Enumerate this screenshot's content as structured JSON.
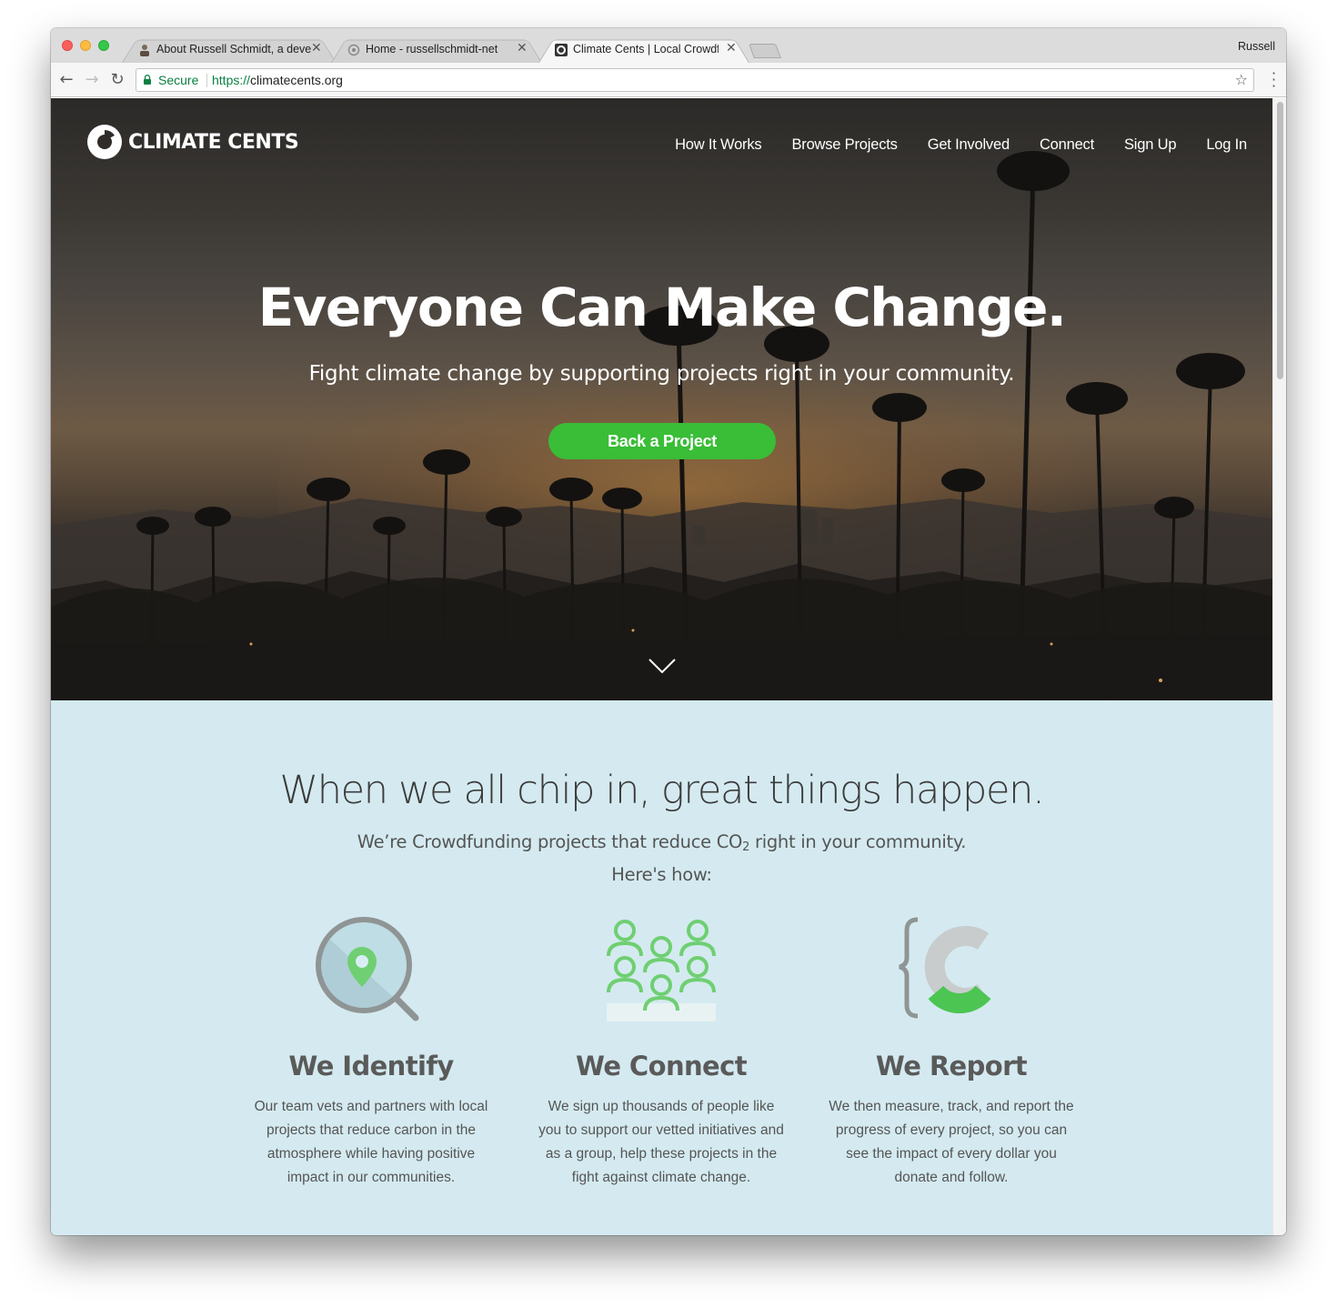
{
  "browser": {
    "tabs": [
      {
        "title": "About Russell Schmidt, a deve",
        "active": false
      },
      {
        "title": "Home - russellschmidt-net",
        "active": false
      },
      {
        "title": "Climate Cents | Local Crowdfu",
        "active": true
      }
    ],
    "profile": "Russell",
    "security_label": "Secure",
    "url_scheme": "https://",
    "url_host": "climatecents.org"
  },
  "site": {
    "logo_text": "CLIMATE CENTS",
    "nav": [
      "How It Works",
      "Browse Projects",
      "Get Involved",
      "Connect",
      "Sign Up",
      "Log In"
    ]
  },
  "hero": {
    "title": "Everyone Can Make Change.",
    "subtitle": "Fight climate change by supporting projects right in your community.",
    "cta": "Back a Project"
  },
  "info": {
    "title": "When we all chip in, great things happen.",
    "subtitle_before": "We’re Crowdfunding projects that reduce CO",
    "subtitle_sub": "2",
    "subtitle_after": " right in your community.",
    "subtitle_line2": "Here's how:",
    "features": [
      {
        "icon": "magnifier-location-icon",
        "title": "We Identify",
        "text": "Our team vets and partners with local projects that reduce carbon in the atmosphere while having positive impact in our communities."
      },
      {
        "icon": "people-group-icon",
        "title": "We Connect",
        "text": "We sign up thousands of people like you to support our vetted initiatives and as a group, help these projects in the fight against climate change."
      },
      {
        "icon": "bracket-c-report-icon",
        "title": "We Report",
        "text": "We then measure, track, and report the progress of every project, so you can see the impact of every dollar you donate and follow."
      }
    ]
  },
  "colors": {
    "brand_green": "#3abd37",
    "info_bg": "#d4eaf0",
    "icon_green": "#6fcf72",
    "icon_gray": "#8f9494"
  }
}
